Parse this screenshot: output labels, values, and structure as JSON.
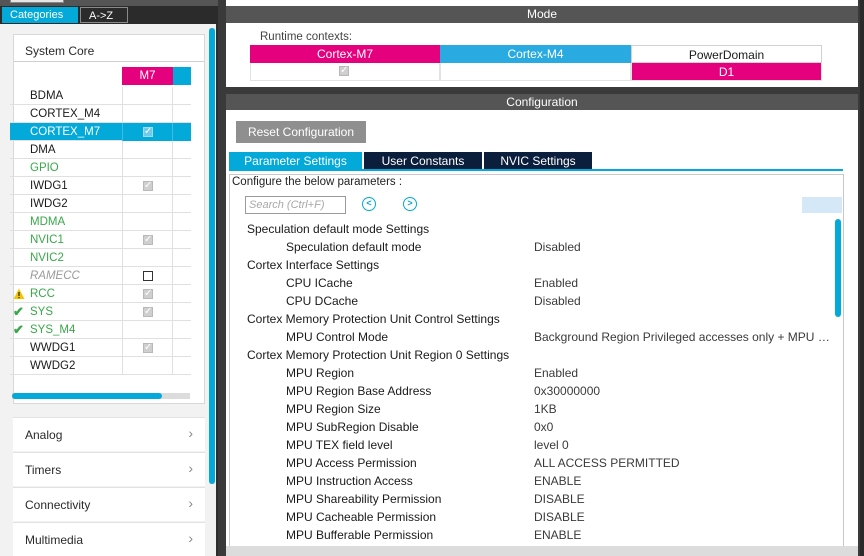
{
  "left": {
    "tabs": [
      {
        "label": "Categories"
      },
      {
        "label": "A->Z"
      }
    ],
    "system_core": {
      "title": "System Core",
      "column_header": "M7",
      "items": [
        {
          "name": "BDMA",
          "style": "normal",
          "checked": null,
          "selected": false,
          "status": null
        },
        {
          "name": "CORTEX_M4",
          "style": "normal",
          "checked": null,
          "selected": false,
          "status": null
        },
        {
          "name": "CORTEX_M7",
          "style": "normal",
          "checked": true,
          "selected": true,
          "status": null
        },
        {
          "name": "DMA",
          "style": "normal",
          "checked": null,
          "selected": false,
          "status": null
        },
        {
          "name": "GPIO",
          "style": "green",
          "checked": null,
          "selected": false,
          "status": null
        },
        {
          "name": "IWDG1",
          "style": "normal",
          "checked": true,
          "selected": false,
          "status": null
        },
        {
          "name": "IWDG2",
          "style": "normal",
          "checked": null,
          "selected": false,
          "status": null
        },
        {
          "name": "MDMA",
          "style": "green",
          "checked": null,
          "selected": false,
          "status": null
        },
        {
          "name": "NVIC1",
          "style": "green",
          "checked": true,
          "selected": false,
          "status": null
        },
        {
          "name": "NVIC2",
          "style": "green",
          "checked": null,
          "selected": false,
          "status": null
        },
        {
          "name": "RAMECC",
          "style": "italic",
          "checked": false,
          "selected": false,
          "status": null
        },
        {
          "name": "RCC",
          "style": "green",
          "checked": true,
          "selected": false,
          "status": "warning-icon"
        },
        {
          "name": "SYS",
          "style": "green",
          "checked": true,
          "selected": false,
          "status": "check-icon"
        },
        {
          "name": "SYS_M4",
          "style": "green",
          "checked": null,
          "selected": false,
          "status": "check-icon"
        },
        {
          "name": "WWDG1",
          "style": "normal",
          "checked": true,
          "selected": false,
          "status": null
        },
        {
          "name": "WWDG2",
          "style": "normal",
          "checked": null,
          "selected": false,
          "status": null
        }
      ]
    },
    "categories": [
      {
        "label": "Analog"
      },
      {
        "label": "Timers"
      },
      {
        "label": "Connectivity"
      },
      {
        "label": "Multimedia"
      }
    ],
    "chevron": "›"
  },
  "mode": {
    "title": "Mode",
    "runtime_label": "Runtime contexts:",
    "contexts": [
      {
        "label": "Cortex-M7",
        "color": "#e5007e",
        "value": "✓",
        "value_bg": "#ffffff"
      },
      {
        "label": "Cortex-M4",
        "color": "#29abe2",
        "value": "",
        "value_bg": "#ffffff"
      },
      {
        "label": "PowerDomain",
        "color": "#ffffff",
        "value": "D1",
        "value_bg": "#e5007e"
      }
    ]
  },
  "configuration": {
    "title": "Configuration",
    "reset_label": "Reset Configuration",
    "tabs": [
      {
        "label": "Parameter Settings",
        "active": true
      },
      {
        "label": "User Constants",
        "active": false
      },
      {
        "label": "NVIC Settings",
        "active": false
      }
    ],
    "note": "Configure the below parameters :",
    "search_placeholder": "Search (Ctrl+F)",
    "params": [
      {
        "type": "group",
        "label": "Speculation default mode Settings",
        "value": ""
      },
      {
        "type": "item",
        "label": "Speculation default mode",
        "value": "Disabled"
      },
      {
        "type": "group",
        "label": "Cortex Interface Settings",
        "value": ""
      },
      {
        "type": "item",
        "label": "CPU ICache",
        "value": "Enabled"
      },
      {
        "type": "item",
        "label": "CPU DCache",
        "value": "Disabled"
      },
      {
        "type": "group",
        "label": "Cortex Memory Protection Unit Control Settings",
        "value": ""
      },
      {
        "type": "item",
        "label": "MPU Control Mode",
        "value": "Background Region Privileged accesses only + MPU D..."
      },
      {
        "type": "group",
        "label": "Cortex Memory Protection Unit Region 0 Settings",
        "value": ""
      },
      {
        "type": "item",
        "label": "MPU Region",
        "value": "Enabled"
      },
      {
        "type": "item",
        "label": "MPU Region Base Address",
        "value": "0x30000000"
      },
      {
        "type": "item",
        "label": "MPU Region Size",
        "value": "1KB"
      },
      {
        "type": "item",
        "label": "MPU SubRegion Disable",
        "value": "0x0"
      },
      {
        "type": "item",
        "label": "MPU TEX field level",
        "value": "level 0"
      },
      {
        "type": "item",
        "label": "MPU Access Permission",
        "value": "ALL ACCESS PERMITTED"
      },
      {
        "type": "item",
        "label": "MPU Instruction Access",
        "value": "ENABLE"
      },
      {
        "type": "item",
        "label": "MPU Shareability Permission",
        "value": "DISABLE"
      },
      {
        "type": "item",
        "label": "MPU Cacheable Permission",
        "value": "DISABLE"
      },
      {
        "type": "item",
        "label": "MPU Bufferable  Permission",
        "value": "ENABLE"
      }
    ]
  }
}
